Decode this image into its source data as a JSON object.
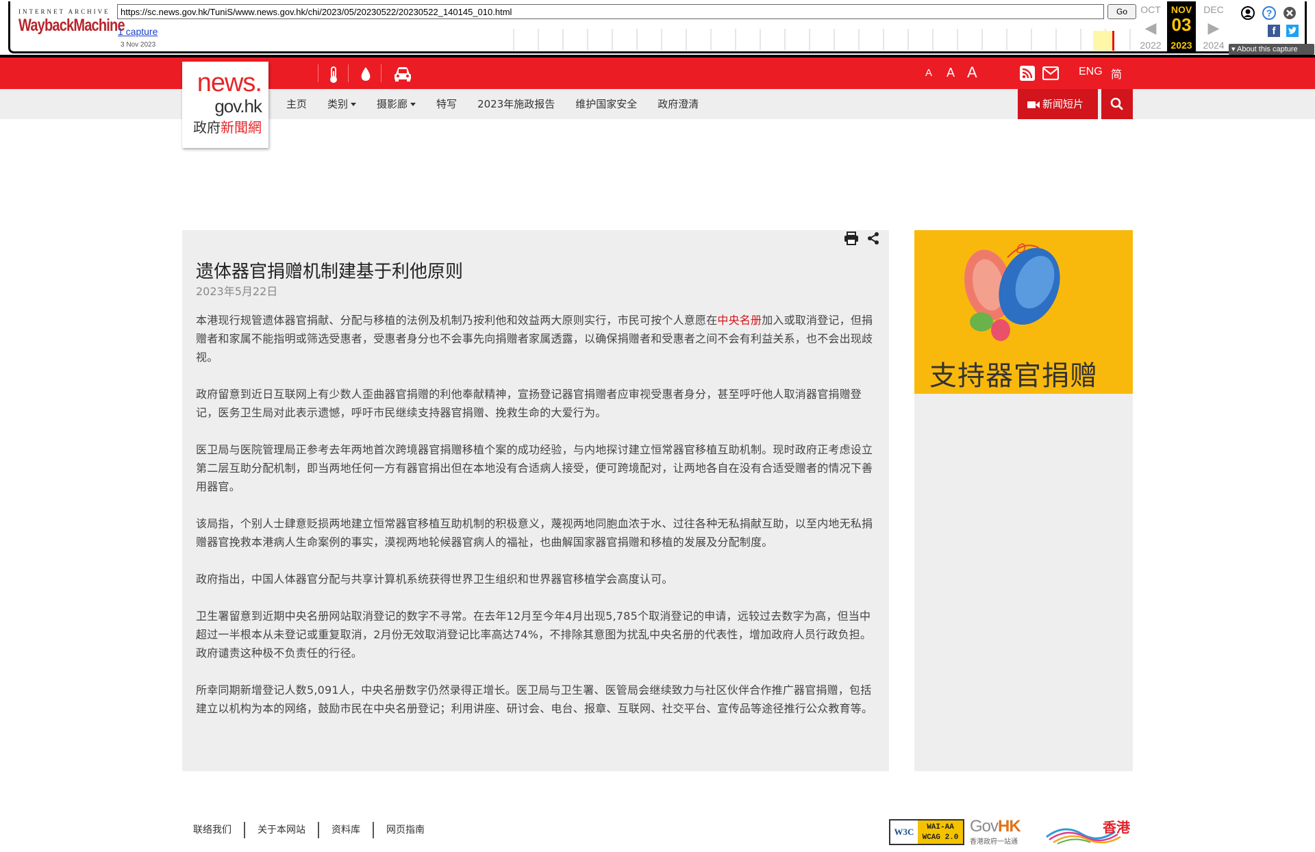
{
  "wayback": {
    "logo_top": "INTERNET ARCHIVE",
    "logo_main": "WaybackMachine",
    "url": "https://sc.news.gov.hk/TuniS/www.news.gov.hk/chi/2023/05/20230522/20230522_140145_010.html",
    "go_label": "Go",
    "captures_label": "1 capture",
    "capture_date": "3 Nov 2023",
    "cal_prev_month": "OCT",
    "cal_prev_year": "2022",
    "cal_cur_month": "NOV",
    "cal_cur_day": "03",
    "cal_cur_year": "2023",
    "cal_next_month": "DEC",
    "cal_next_year": "2024",
    "about_label": "About this capture"
  },
  "header": {
    "logo_line1": "news.",
    "logo_line2": "gov.hk",
    "logo_line3a": "政府",
    "logo_line3b": "新聞網",
    "font_small": "A",
    "font_medium": "A",
    "font_large": "A",
    "lang_eng": "ENG",
    "lang_sc": "简"
  },
  "nav": {
    "items": [
      {
        "label": "主页",
        "dropdown": false
      },
      {
        "label": "类别",
        "dropdown": true
      },
      {
        "label": "摄影廊",
        "dropdown": true
      },
      {
        "label": "特写",
        "dropdown": false
      },
      {
        "label": "2023年施政报告",
        "dropdown": false
      },
      {
        "label": "维护国家安全",
        "dropdown": false
      },
      {
        "label": "政府澄清",
        "dropdown": false
      }
    ],
    "video_label": "新闻短片"
  },
  "article": {
    "title": "遗体器官捐赠机制建基于利他原则",
    "date": "2023年5月22日",
    "p1_before": "本港现行规管遗体器官捐献、分配与移植的法例及机制乃按利他和效益两大原则实行，市民可按个人意愿在",
    "p1_link": "中央名册",
    "p1_after": "加入或取消登记，但捐赠者和家属不能指明或筛选受惠者，受惠者身分也不会事先向捐赠者家属透露，以确保捐赠者和受惠者之间不会有利益关系，也不会出现歧视。",
    "p2": "政府留意到近日互联网上有少数人歪曲器官捐赠的利他奉献精神，宣扬登记器官捐赠者应审视受惠者身分，甚至呼吁他人取消器官捐赠登记，医务卫生局对此表示遗憾，呼吁市民继续支持器官捐赠、挽救生命的大爱行为。",
    "p3": "医卫局与医院管理局正参考去年两地首次跨境器官捐赠移植个案的成功经验，与内地探讨建立恒常器官移植互助机制。现时政府正考虑设立第二层互助分配机制，即当两地任何一方有器官捐出但在本地没有合适病人接受，便可跨境配对，让两地各自在没有合适受赠者的情况下善用器官。",
    "p4": "该局指，个别人士肆意贬损两地建立恒常器官移植互助机制的积极意义，蔑视两地同胞血浓于水、过往各种无私捐献互助，以至内地无私捐赠器官挽救本港病人生命案例的事实，漠视两地轮候器官病人的福祉，也曲解国家器官捐赠和移植的发展及分配制度。",
    "p5": "政府指出，中国人体器官分配与共享计算机系统获得世界卫生组织和世界器官移植学会高度认可。",
    "p6": "卫生署留意到近期中央名册网站取消登记的数字不寻常。在去年12月至今年4月出现5,785个取消登记的申请，远较过去数字为高，但当中超过一半根本从未登记或重复取消，2月份无效取消登记比率高达74%，不排除其意图为扰乱中央名册的代表性，增加政府人员行政负担。政府谴责这种极不负责任的行径。",
    "p7": "所幸同期新增登记人数5,091人，中央名册数字仍然录得正增长。医卫局与卫生署、医管局会继续致力与社区伙伴合作推广器官捐赠，包括建立以机构为本的网络，鼓励市民在中央名册登记；利用讲座、研讨会、电台、报章、互联网、社交平台、宣传品等途径推行公众教育等。"
  },
  "sidebar": {
    "banner_text": "支持器官捐赠"
  },
  "footer": {
    "links": [
      "联络我们",
      "关于本网站",
      "资料库",
      "网页指南"
    ],
    "w3c_a": "W3C",
    "w3c_b1": "WAI-AA",
    "w3c_b2": "WCAG 2.0",
    "govhk_gov": "Gov",
    "govhk_hk": "HK",
    "govhk_sub": "香港政府一站通",
    "brandhk": "香港"
  },
  "colors": {
    "brand_red": "#ec1c24",
    "button_red": "#d2141c",
    "banner_yellow": "#f9b90c",
    "wayback_gold": "#ffc800"
  }
}
